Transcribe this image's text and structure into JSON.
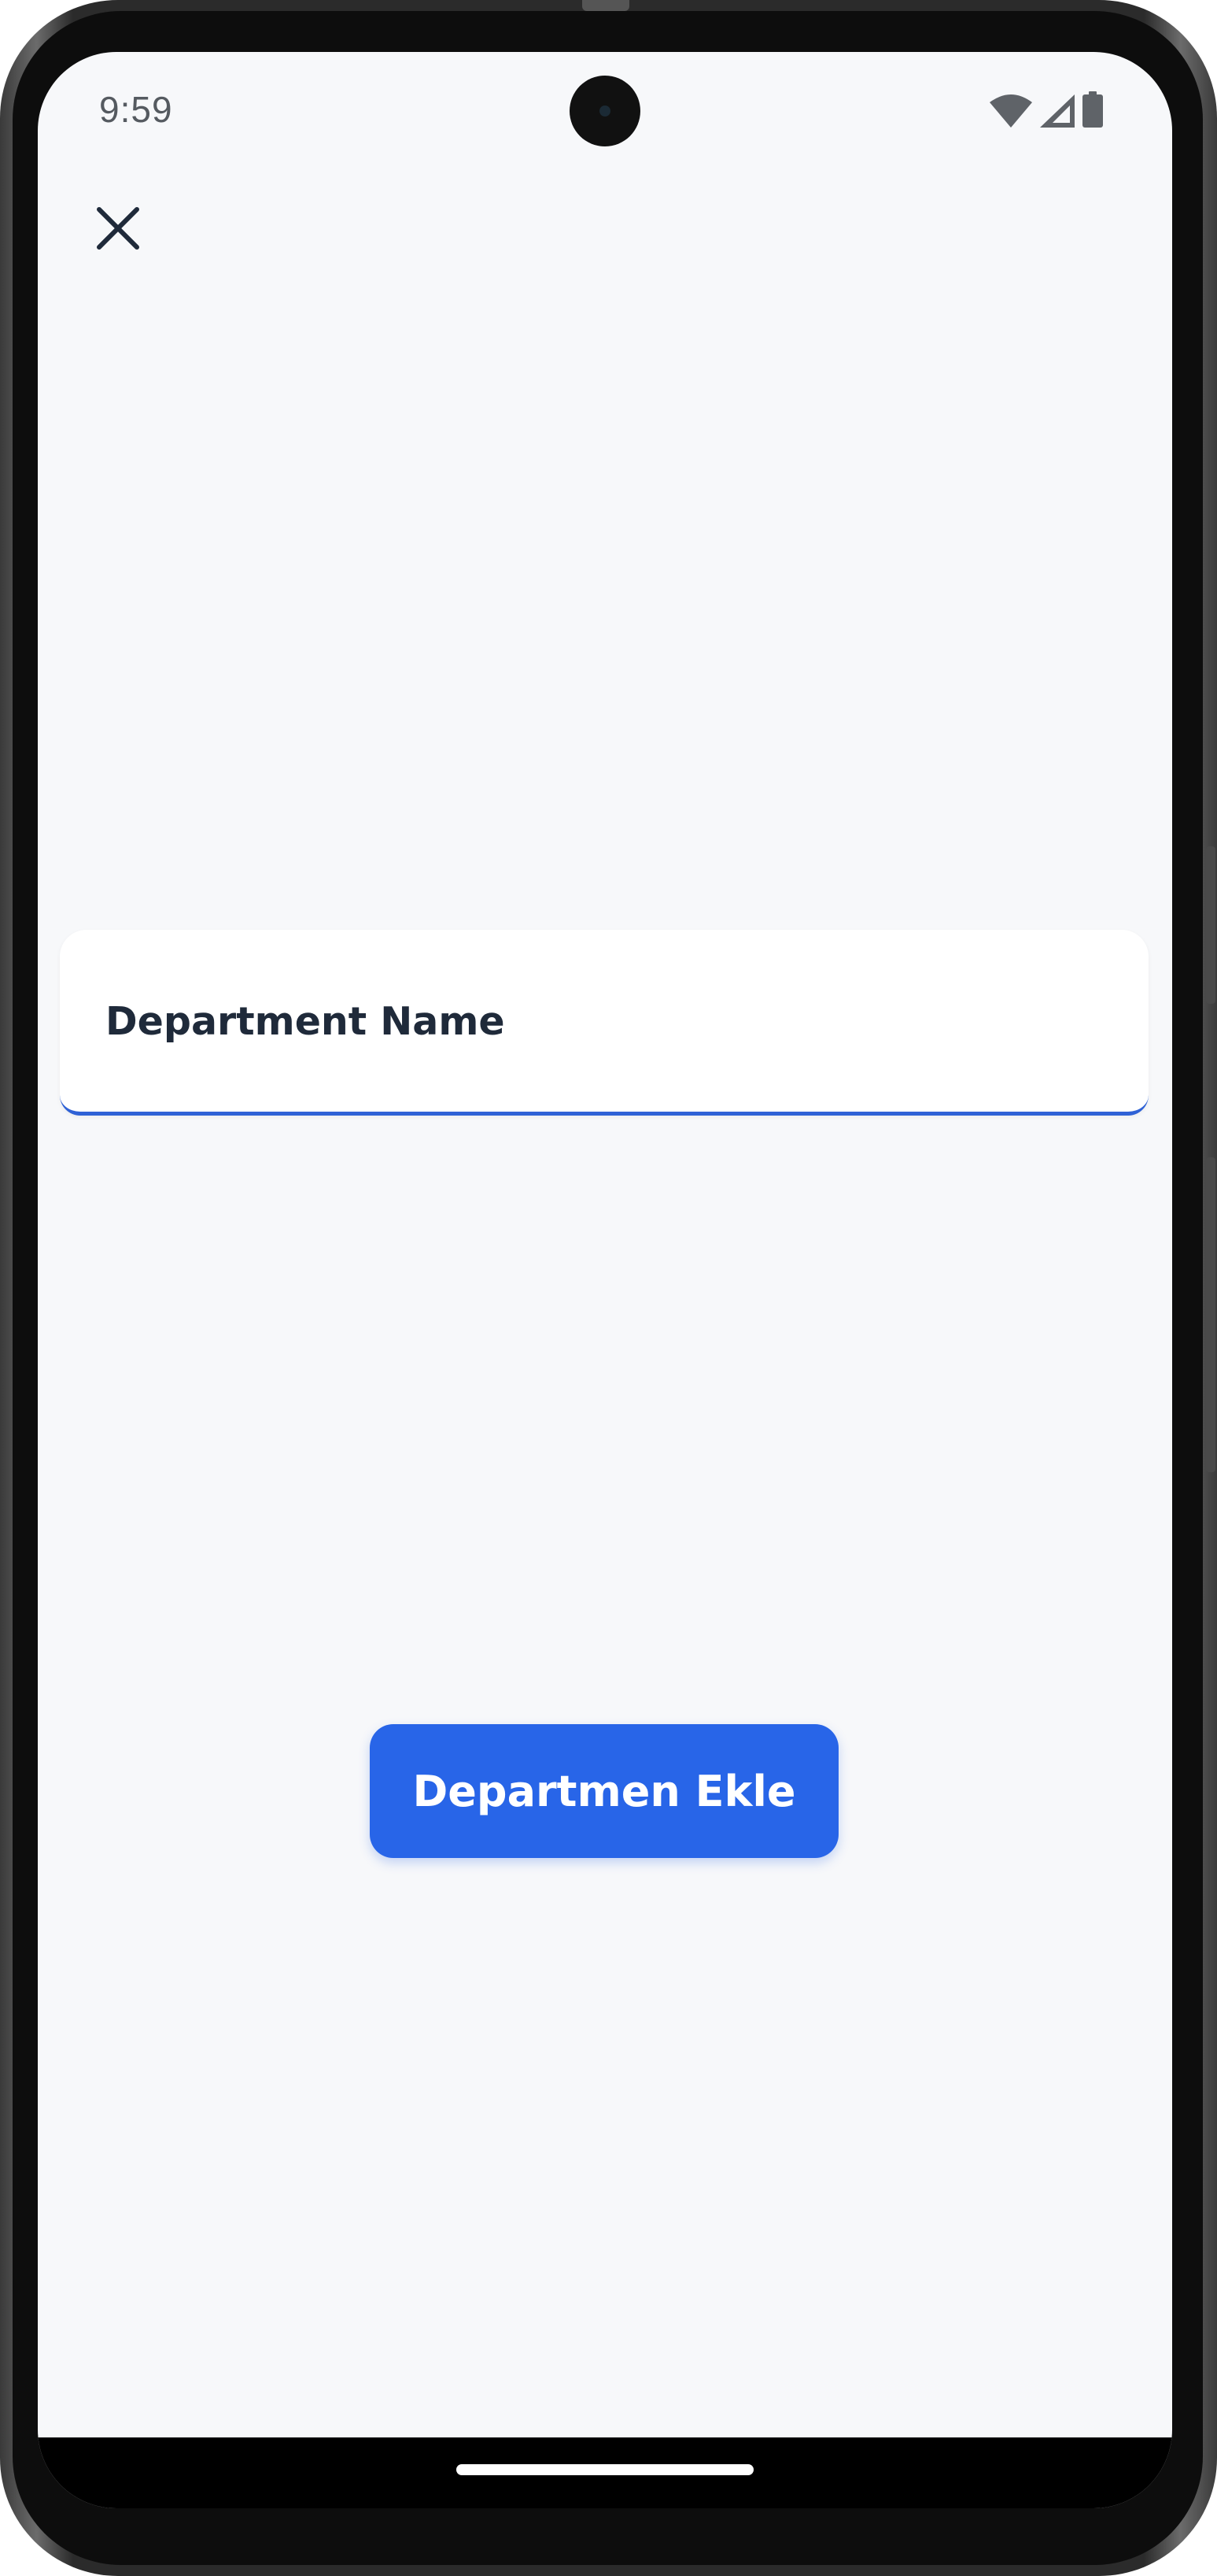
{
  "status_bar": {
    "time": "9:59",
    "icons": [
      "wifi-icon",
      "cellular-signal-icon",
      "battery-icon"
    ]
  },
  "toolbar": {
    "close_icon": "close-icon"
  },
  "form": {
    "department_name": {
      "placeholder": "Department Name",
      "value": ""
    },
    "submit_label": "Departmen Ekle"
  },
  "colors": {
    "background": "#f7f8fa",
    "accent": "#2865e8",
    "underline": "#2f62d6",
    "text_dark": "#1f2a3a"
  }
}
